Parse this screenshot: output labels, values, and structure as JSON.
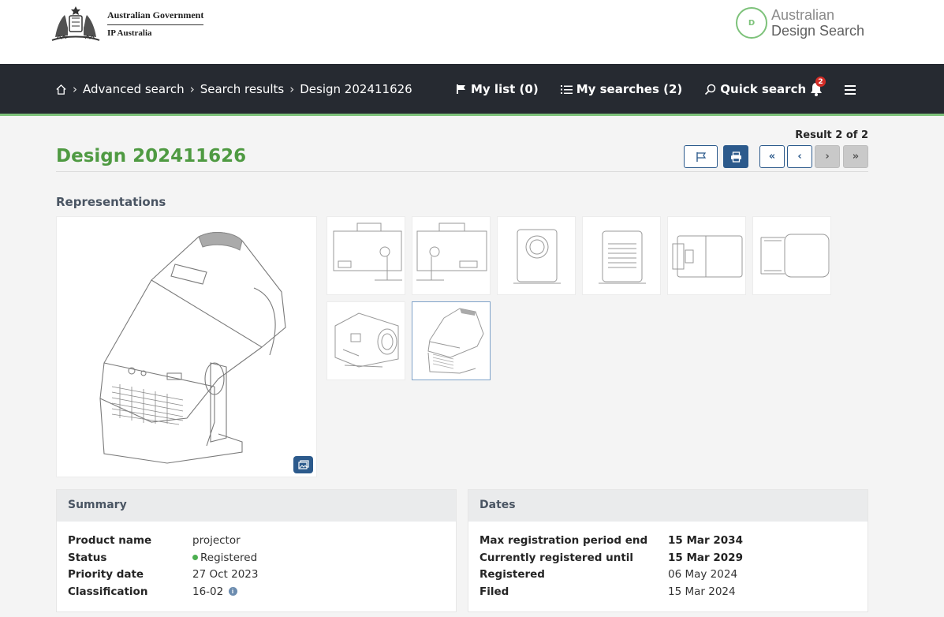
{
  "header": {
    "gov_line1": "Australian Government",
    "gov_line2": "IP Australia",
    "ads_badge": "D",
    "ads_line1": "Australian",
    "ads_line2": "Design Search"
  },
  "nav": {
    "breadcrumbs": [
      "Advanced search",
      "Search results",
      "Design 202411626"
    ],
    "my_list": "My list (0)",
    "my_searches": "My searches (2)",
    "quick_search": "Quick search",
    "notification_count": "2"
  },
  "toolbar": {
    "result_count": "Result 2 of 2",
    "first_label": "«",
    "prev_label": "‹",
    "next_label": "›",
    "last_label": "»"
  },
  "page": {
    "title": "Design 202411626",
    "representations_label": "Representations"
  },
  "summary": {
    "heading": "Summary",
    "labels": [
      "Product name",
      "Status",
      "Priority date",
      "Classification"
    ],
    "product_name": "projector",
    "status": "Registered",
    "priority_date": "27 Oct 2023",
    "classification": "16-02"
  },
  "dates": {
    "heading": "Dates",
    "labels": [
      "Max registration period end",
      "Currently registered until",
      "Registered",
      "Filed"
    ],
    "values": [
      "15 Mar 2034",
      "15 Mar 2029",
      "06 May 2024",
      "15 Mar 2024"
    ]
  },
  "colors": {
    "accent_green": "#4f9a42",
    "nav_bg": "#262a31",
    "button_blue": "#2c5a8c"
  }
}
